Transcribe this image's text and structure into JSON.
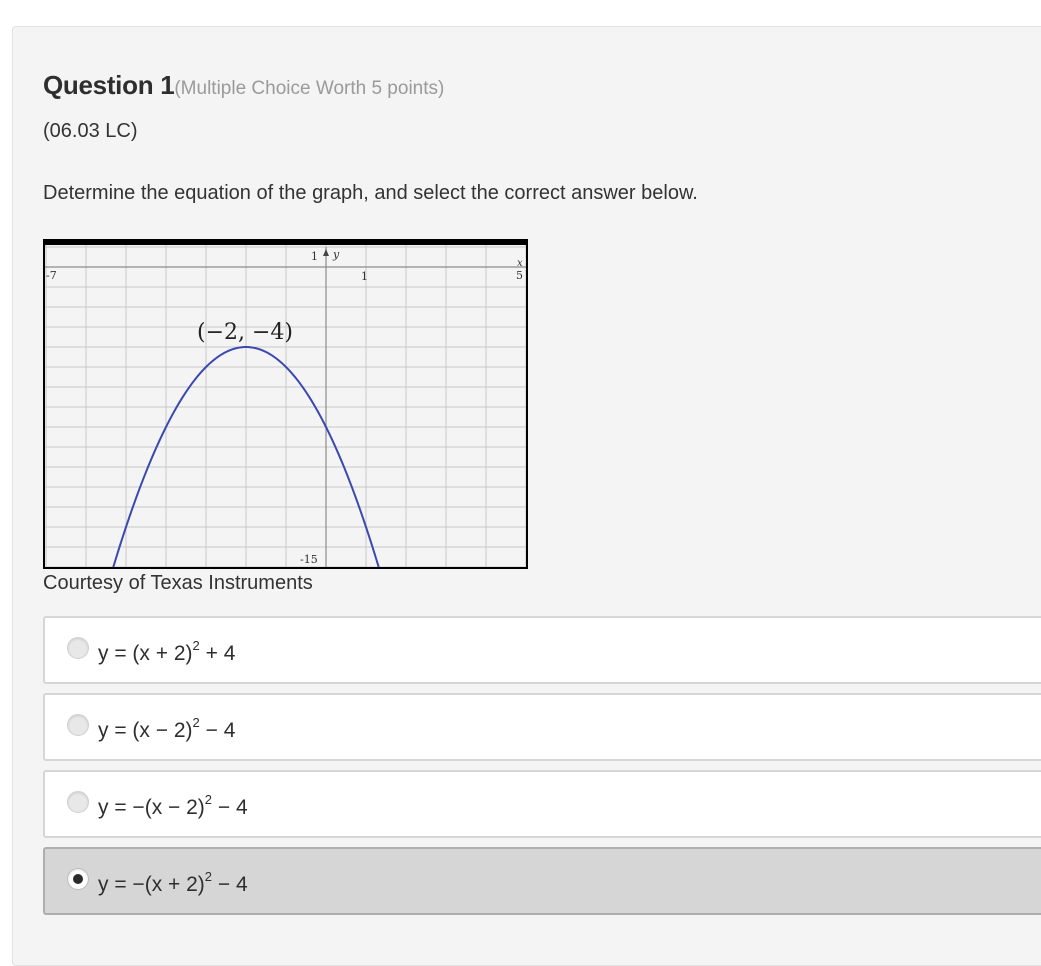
{
  "question": {
    "number_label": "Question 1",
    "meta": "(Multiple Choice Worth 5 points)",
    "code": "(06.03 LC)",
    "prompt": "Determine the equation of the graph, and select the correct answer below.",
    "caption": "Courtesy of Texas Instruments"
  },
  "graph": {
    "labels": {
      "xmin": "-7",
      "xmax": "5",
      "x_tick": "1",
      "y_tick": "1",
      "ymin": "-15",
      "y_axis": "y",
      "x_axis": "x",
      "vertex": "(−2, −4)"
    },
    "x_range": [
      -7,
      5
    ],
    "y_range": [
      -15,
      1
    ],
    "curve": {
      "a": -1,
      "h": -2,
      "k": -4
    },
    "colors": {
      "curve": "#3a48b0",
      "grid": "#c8c8c8",
      "frame": "#000000"
    }
  },
  "options": [
    {
      "lhs": "y = (x + 2)",
      "exp": "2",
      "rhs": " + 4",
      "selected": false
    },
    {
      "lhs": "y = (x − 2)",
      "exp": "2",
      "rhs": " − 4",
      "selected": false
    },
    {
      "lhs": "y = −(x − 2)",
      "exp": "2",
      "rhs": " − 4",
      "selected": false
    },
    {
      "lhs": "y = −(x + 2)",
      "exp": "2",
      "rhs": " − 4",
      "selected": true
    }
  ]
}
